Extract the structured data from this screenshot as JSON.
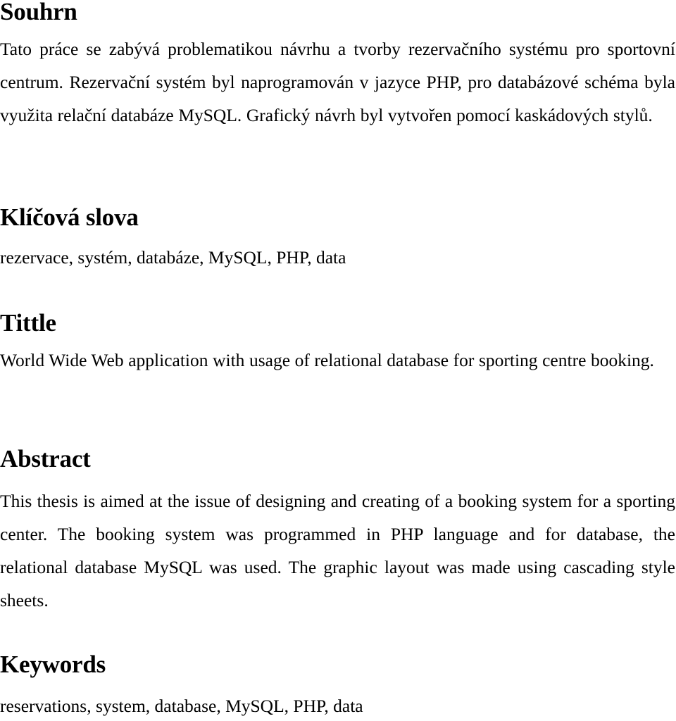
{
  "document": {
    "language_primary": "cs",
    "text_color": "#000000",
    "background_color": "#ffffff"
  },
  "sections": {
    "souhrn": {
      "heading": "Souhrn",
      "body": "Tato práce se zabývá problematikou návrhu a tvorby rezervačního systému pro sportovní centrum. Rezervační systém byl naprogramován v jazyce PHP, pro databázové schéma byla využita relační databáze MySQL. Grafický návrh byl vytvořen pomocí kaskádových stylů.",
      "lines": [
        "Tato práce se zabývá problematikou návrhu a tvorby rezervačního systému",
        "pro sportovní centrum. Rezervační systém byl naprogramován v jazyce PHP,",
        "pro databázové schéma byla využita relační databáze MySQL. Grafický návrh byl",
        "vytvořen pomocí kaskádových stylů."
      ]
    },
    "klicova_slova": {
      "heading": "Klíčová slova",
      "body": "rezervace, systém, databáze, MySQL, PHP, data",
      "terms": [
        "rezervace",
        "systém",
        "databáze",
        "MySQL",
        "PHP",
        "data"
      ]
    },
    "tittle": {
      "heading": "Tittle",
      "body": "World Wide Web application with usage of relational database for sporting centre booking.",
      "lines": [
        "World Wide Web application with usage of relational database for sporting centre",
        "booking."
      ]
    },
    "abstract": {
      "heading": "Abstract",
      "body": "This thesis is aimed at the issue of designing and creating of a booking system for a sporting center. The booking system was programmed in PHP language and for database, the relational database MySQL was used. The graphic layout was made using cascading style sheets.",
      "lines": [
        "This thesis is aimed at the issue of designing and creating of a booking system for a",
        "sporting center. The booking system was programmed in PHP language",
        "and for database, the relational database MySQL was used. The graphic layout was",
        "made using cascading style sheets."
      ]
    },
    "keywords": {
      "heading": "Keywords",
      "body": "reservations, system, database, MySQL, PHP, data",
      "terms": [
        "reservations",
        "system",
        "database",
        "MySQL",
        "PHP",
        "data"
      ]
    }
  }
}
